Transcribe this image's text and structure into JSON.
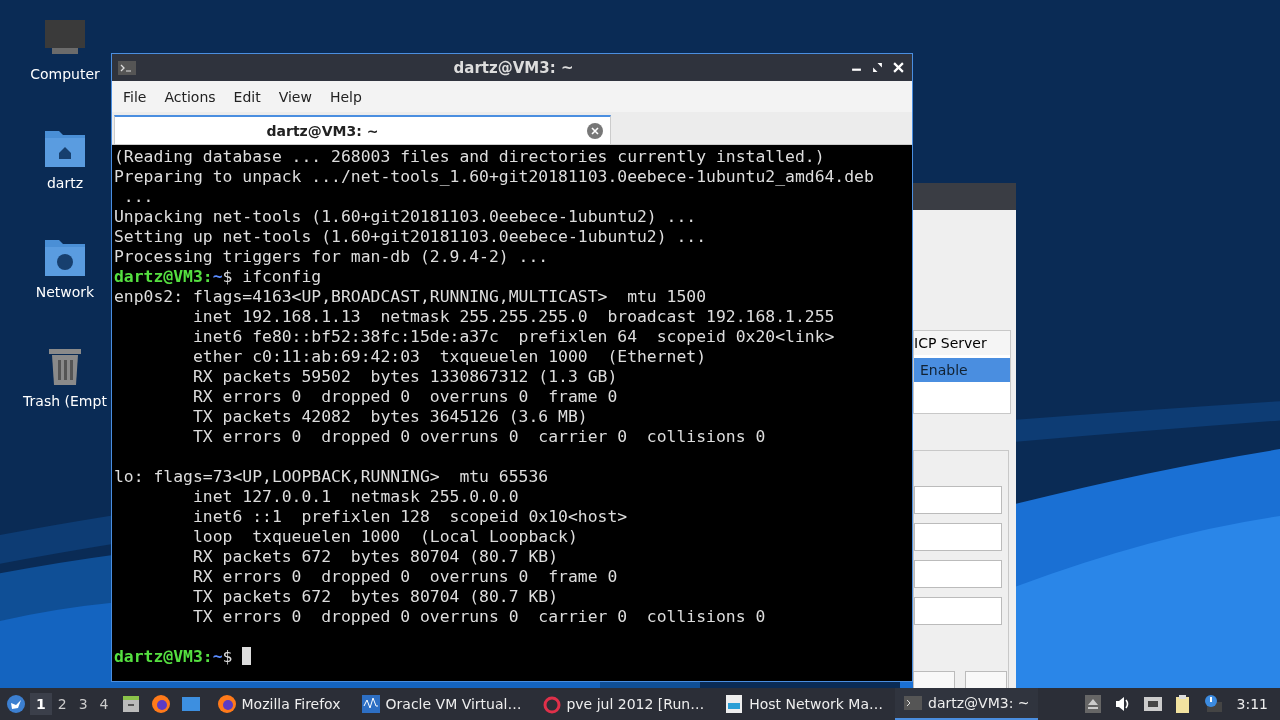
{
  "desktop_icons": [
    {
      "label": "Computer",
      "kind": "computer"
    },
    {
      "label": "dartz",
      "kind": "home"
    },
    {
      "label": "Network",
      "kind": "network"
    },
    {
      "label": "Trash (Empt",
      "kind": "trash"
    }
  ],
  "background_dialog": {
    "list_header": "ICP Server",
    "list_items": [
      {
        "label": "Enable",
        "selected": true
      }
    ]
  },
  "terminal": {
    "title": "dartz@VM3: ~",
    "menu": [
      "File",
      "Actions",
      "Edit",
      "View",
      "Help"
    ],
    "tabs": [
      {
        "label": "dartz@VM3: ~",
        "selected": true
      }
    ],
    "lines": [
      {
        "kind": "output",
        "text": "(Reading database ... 268003 files and directories currently installed.)"
      },
      {
        "kind": "output",
        "text": "Preparing to unpack .../net-tools_1.60+git20181103.0eebece-1ubuntu2_amd64.deb"
      },
      {
        "kind": "output",
        "text": " ..."
      },
      {
        "kind": "output",
        "text": "Unpacking net-tools (1.60+git20181103.0eebece-1ubuntu2) ..."
      },
      {
        "kind": "output",
        "text": "Setting up net-tools (1.60+git20181103.0eebece-1ubuntu2) ..."
      },
      {
        "kind": "output",
        "text": "Processing triggers for man-db (2.9.4-2) ..."
      },
      {
        "kind": "prompt",
        "host": "dartz@VM3:",
        "path": "~",
        "symbol": "$",
        "command": "ifconfig"
      },
      {
        "kind": "output",
        "text": "enp0s2: flags=4163<UP,BROADCAST,RUNNING,MULTICAST>  mtu 1500"
      },
      {
        "kind": "output",
        "text": "        inet 192.168.1.13  netmask 255.255.255.0  broadcast 192.168.1.255"
      },
      {
        "kind": "output",
        "text": "        inet6 fe80::bf52:38fc:15de:a37c  prefixlen 64  scopeid 0x20<link>"
      },
      {
        "kind": "output",
        "text": "        ether c0:11:ab:69:42:03  txqueuelen 1000  (Ethernet)"
      },
      {
        "kind": "output",
        "text": "        RX packets 59502  bytes 1330867312 (1.3 GB)"
      },
      {
        "kind": "output",
        "text": "        RX errors 0  dropped 0  overruns 0  frame 0"
      },
      {
        "kind": "output",
        "text": "        TX packets 42082  bytes 3645126 (3.6 MB)"
      },
      {
        "kind": "output",
        "text": "        TX errors 0  dropped 0 overruns 0  carrier 0  collisions 0"
      },
      {
        "kind": "blank"
      },
      {
        "kind": "output",
        "text": "lo: flags=73<UP,LOOPBACK,RUNNING>  mtu 65536"
      },
      {
        "kind": "output",
        "text": "        inet 127.0.0.1  netmask 255.0.0.0"
      },
      {
        "kind": "output",
        "text": "        inet6 ::1  prefixlen 128  scopeid 0x10<host>"
      },
      {
        "kind": "output",
        "text": "        loop  txqueuelen 1000  (Local Loopback)"
      },
      {
        "kind": "output",
        "text": "        RX packets 672  bytes 80704 (80.7 KB)"
      },
      {
        "kind": "output",
        "text": "        RX errors 0  dropped 0  overruns 0  frame 0"
      },
      {
        "kind": "output",
        "text": "        TX packets 672  bytes 80704 (80.7 KB)"
      },
      {
        "kind": "output",
        "text": "        TX errors 0  dropped 0 overruns 0  carrier 0  collisions 0"
      },
      {
        "kind": "blank"
      },
      {
        "kind": "prompt",
        "host": "dartz@VM3:",
        "path": "~",
        "symbol": "$",
        "cursor": true
      }
    ]
  },
  "taskbar": {
    "workspaces": [
      {
        "label": "1",
        "selected": true
      },
      {
        "label": "2",
        "selected": false
      },
      {
        "label": "3",
        "selected": false
      },
      {
        "label": "4",
        "selected": false
      }
    ],
    "tasks": [
      {
        "label": "Mozilla Firefox",
        "kind": "firefox",
        "selected": false
      },
      {
        "label": "Oracle VM Virtual…",
        "kind": "vbox",
        "selected": false
      },
      {
        "label": "pve jul 2012 [Run…",
        "kind": "vm",
        "selected": false
      },
      {
        "label": "Host Network Ma…",
        "kind": "netmgr",
        "selected": false
      },
      {
        "label": "dartz@VM3: ~",
        "kind": "terminal",
        "selected": true
      }
    ],
    "clock": "3:11"
  }
}
